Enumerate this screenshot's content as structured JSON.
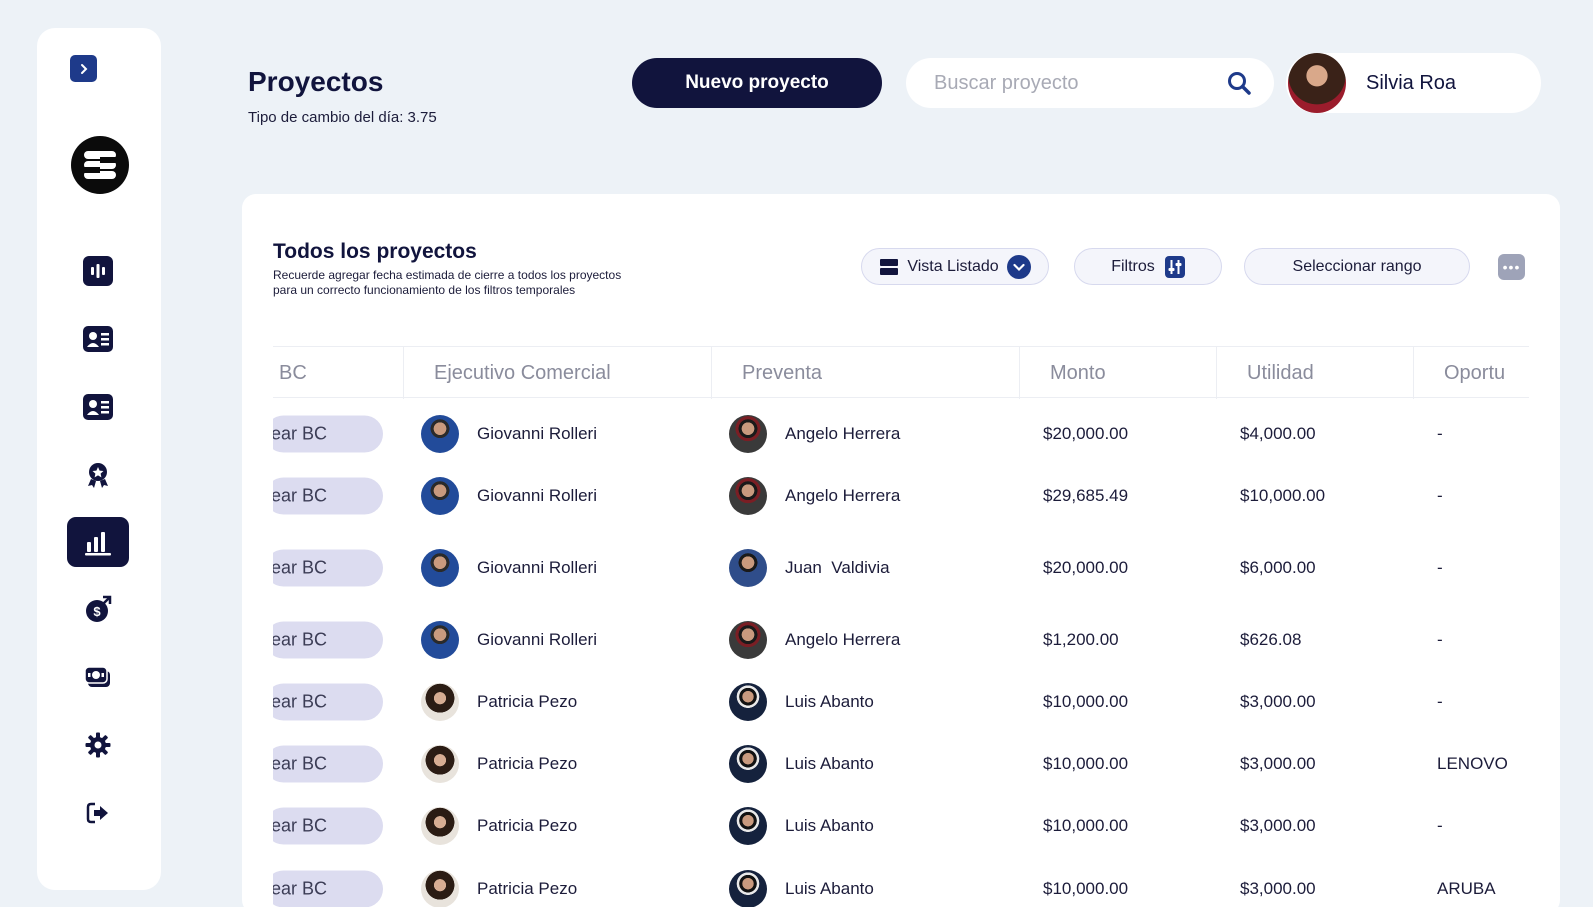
{
  "sidebar": {
    "items": [
      {
        "icon": "dashboard-icon",
        "active": false
      },
      {
        "icon": "contact-card-icon",
        "active": false
      },
      {
        "icon": "id-card-icon",
        "active": false
      },
      {
        "icon": "award-icon",
        "active": false
      },
      {
        "icon": "bar-chart-icon",
        "active": true
      },
      {
        "icon": "money-bag-icon",
        "active": false
      },
      {
        "icon": "cash-icon",
        "active": false
      },
      {
        "icon": "gear-icon",
        "active": false
      },
      {
        "icon": "logout-icon",
        "active": false
      }
    ]
  },
  "header": {
    "title": "Proyectos",
    "exchange_rate": "Tipo de cambio del día: 3.75",
    "new_project_label": "Nuevo proyecto",
    "search_placeholder": "Buscar proyecto",
    "user_name": "Silvia Roa"
  },
  "panel": {
    "title": "Todos los proyectos",
    "note_line1": "Recuerde agregar fecha estimada de cierre a todos los proyectos",
    "note_line2": "para un correcto funcionamiento de los filtros temporales",
    "view_label": "Vista Listado",
    "filters_label": "Filtros",
    "range_label": "Seleccionar rango",
    "more_label": "•••"
  },
  "table": {
    "columns": [
      "BC",
      "Ejecutivo Comercial",
      "Preventa",
      "Monto",
      "Utilidad",
      "Oportu"
    ],
    "bc_button_label": "ear BC",
    "rows": [
      {
        "ejecutivo": "Giovanni Rolleri",
        "preventa": "Angelo Herrera",
        "monto": "$20,000.00",
        "utilidad": "$4,000.00",
        "oportunidad": "-"
      },
      {
        "ejecutivo": "Giovanni Rolleri",
        "preventa": "Angelo Herrera",
        "monto": "$29,685.49",
        "utilidad": "$10,000.00",
        "oportunidad": "-"
      },
      {
        "ejecutivo": "Giovanni Rolleri",
        "preventa": "Juan  Valdivia",
        "monto": "$20,000.00",
        "utilidad": "$6,000.00",
        "oportunidad": "-"
      },
      {
        "ejecutivo": "Giovanni Rolleri",
        "preventa": "Angelo Herrera",
        "monto": "$1,200.00",
        "utilidad": "$626.08",
        "oportunidad": "-"
      },
      {
        "ejecutivo": "Patricia Pezo",
        "preventa": "Luis Abanto",
        "monto": "$10,000.00",
        "utilidad": "$3,000.00",
        "oportunidad": "-"
      },
      {
        "ejecutivo": "Patricia Pezo",
        "preventa": "Luis Abanto",
        "monto": "$10,000.00",
        "utilidad": "$3,000.00",
        "oportunidad": "LENOVO"
      },
      {
        "ejecutivo": "Patricia Pezo",
        "preventa": "Luis Abanto",
        "monto": "$10,000.00",
        "utilidad": "$3,000.00",
        "oportunidad": "-"
      },
      {
        "ejecutivo": "Patricia Pezo",
        "preventa": "Luis Abanto",
        "monto": "$10,000.00",
        "utilidad": "$3,000.00",
        "oportunidad": "ARUBA"
      }
    ]
  },
  "colors": {
    "navy": "#11143d",
    "background": "#edf2f7",
    "chip": "#dcdcf0",
    "toggle": "#1e3a8a"
  }
}
